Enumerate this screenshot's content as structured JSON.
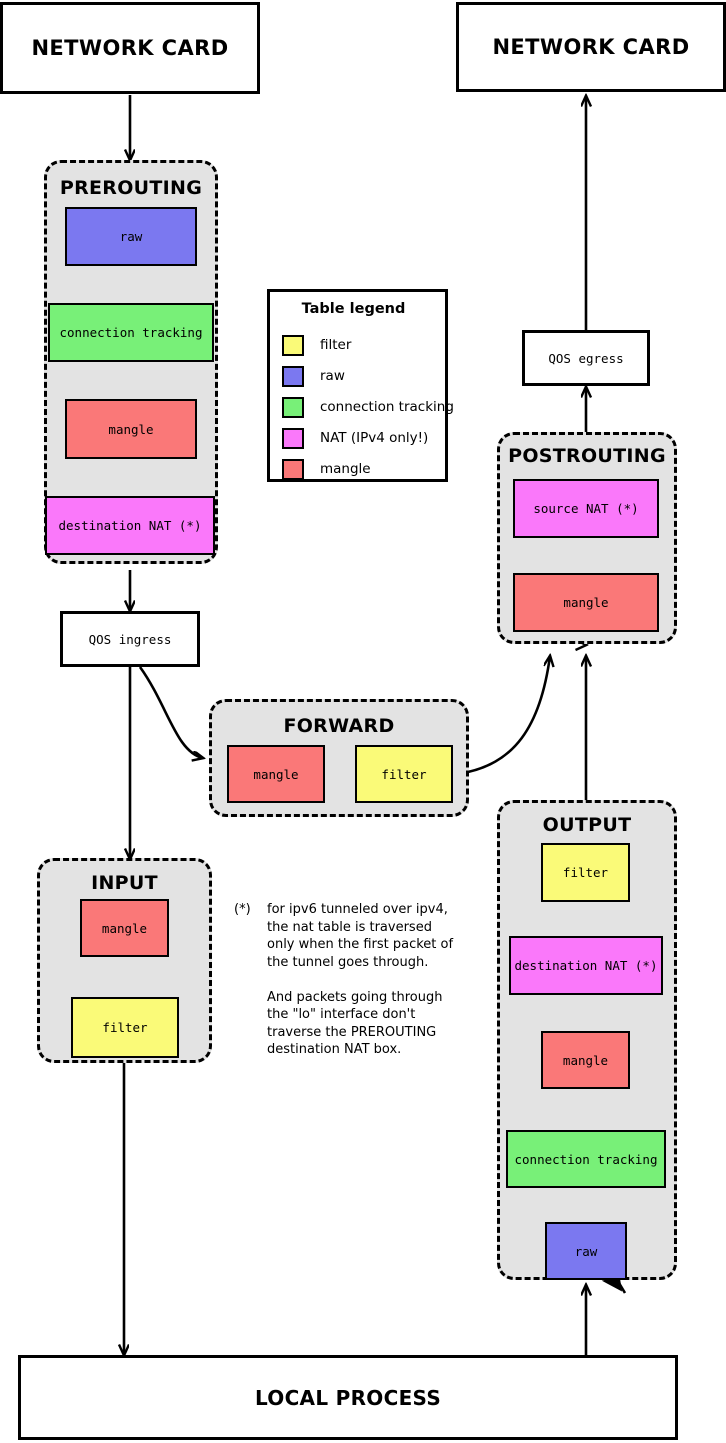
{
  "diagram": {
    "title_top_left": "NETWORK CARD",
    "title_top_right": "NETWORK CARD",
    "bottom_node": "LOCAL PROCESS",
    "qos_ingress": "QOS ingress",
    "qos_egress": "QOS egress"
  },
  "colors": {
    "filter": "#fafa78",
    "raw": "#7b78f0",
    "conntrack": "#78f078",
    "nat": "#fa78fa",
    "mangle": "#fa7878",
    "chain_bg": "#e3e3e3",
    "stroke": "#000000",
    "page_bg": "#ffffff"
  },
  "legend": {
    "title": "Table legend",
    "items": [
      {
        "label": "filter",
        "color": "#fafa78",
        "swatch_name": "legend-swatch-filter"
      },
      {
        "label": "raw",
        "color": "#7b78f0",
        "swatch_name": "legend-swatch-raw"
      },
      {
        "label": "connection tracking",
        "color": "#78f078",
        "swatch_name": "legend-swatch-conntrack"
      },
      {
        "label": "NAT  (IPv4 only!)",
        "color": "#fa78fa",
        "swatch_name": "legend-swatch-nat"
      },
      {
        "label": "mangle",
        "color": "#fa7878",
        "swatch_name": "legend-swatch-mangle"
      }
    ]
  },
  "chains": {
    "prerouting": {
      "title": "PREROUTING",
      "boxes": [
        {
          "label": "raw",
          "color": "#7b78f0"
        },
        {
          "label": "connection tracking",
          "color": "#78f078"
        },
        {
          "label": "mangle",
          "color": "#fa7878"
        },
        {
          "label": "destination NAT (*)",
          "color": "#fa78fa"
        }
      ]
    },
    "forward": {
      "title": "FORWARD",
      "boxes": [
        {
          "label": "mangle",
          "color": "#fa7878"
        },
        {
          "label": "filter",
          "color": "#fafa78"
        }
      ]
    },
    "input": {
      "title": "INPUT",
      "boxes": [
        {
          "label": "mangle",
          "color": "#fa7878"
        },
        {
          "label": "filter",
          "color": "#fafa78"
        }
      ]
    },
    "output": {
      "title": "OUTPUT",
      "boxes": [
        {
          "label": "filter",
          "color": "#fafa78"
        },
        {
          "label": "destination NAT (*)",
          "color": "#fa78fa"
        },
        {
          "label": "mangle",
          "color": "#fa7878"
        },
        {
          "label": "connection tracking",
          "color": "#78f078"
        },
        {
          "label": "raw",
          "color": "#7b78f0"
        }
      ]
    },
    "postrouting": {
      "title": "POSTROUTING",
      "boxes": [
        {
          "label": "source NAT (*)",
          "color": "#fa78fa"
        },
        {
          "label": "mangle",
          "color": "#fa7878"
        }
      ]
    }
  },
  "footnote": {
    "marker": "(*)",
    "paragraph_1": "for ipv6 tunneled over ipv4, the nat table is traversed only when the first packet of the tunnel goes through.",
    "paragraph_2": "And packets going through the \"lo\" interface don't traverse the PREROUTING destination NAT box."
  }
}
